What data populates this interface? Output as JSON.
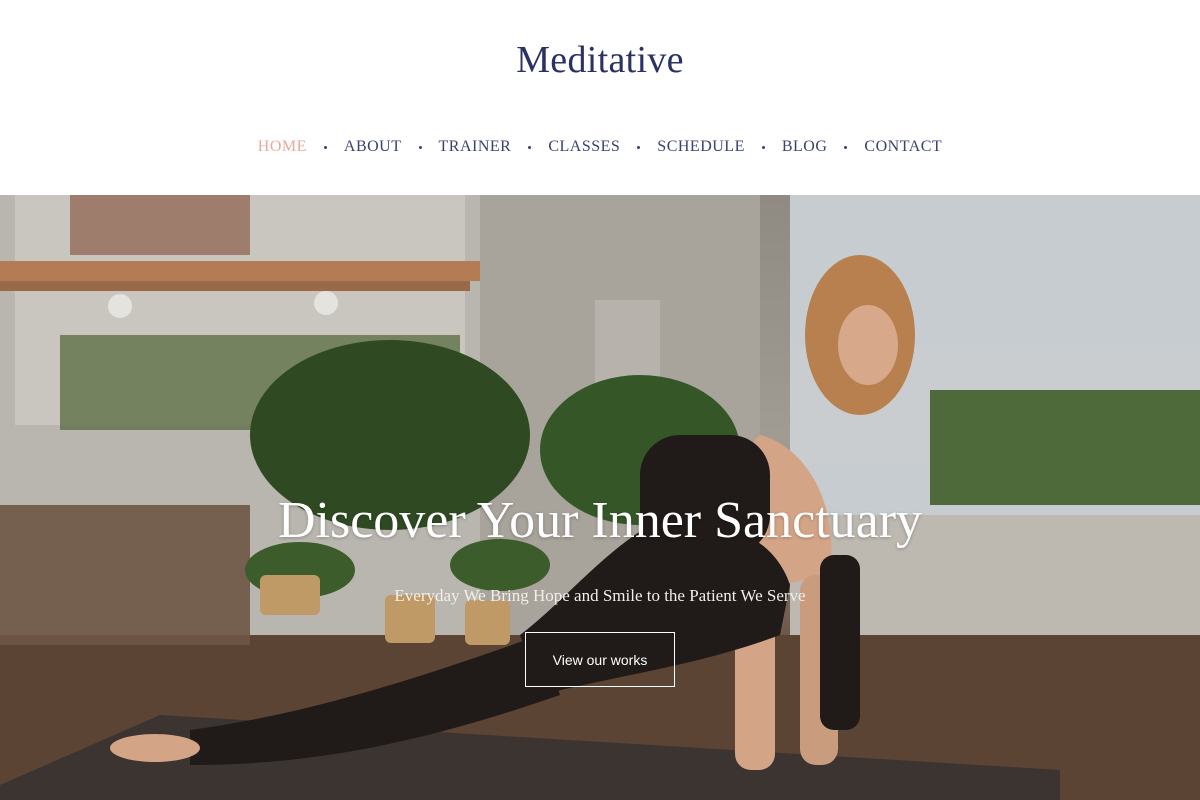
{
  "brand": {
    "name": "Meditative"
  },
  "nav": {
    "items": [
      {
        "label": "HOME",
        "active": true
      },
      {
        "label": "ABOUT"
      },
      {
        "label": "TRAINER"
      },
      {
        "label": "CLASSES"
      },
      {
        "label": "SCHEDULE"
      },
      {
        "label": "BLOG"
      },
      {
        "label": "CONTACT"
      }
    ]
  },
  "hero": {
    "title": "Discover Your Inner Sanctuary",
    "subtitle": "Everyday We Bring Hope and Smile to the Patient We Serve",
    "button_label": "View our works",
    "image": "yoga-studio-stretch-photo"
  },
  "colors": {
    "brand": "#2a3263",
    "nav_text": "#3b4170",
    "nav_active": "#e8a99b",
    "hero_text": "#ffffff"
  }
}
